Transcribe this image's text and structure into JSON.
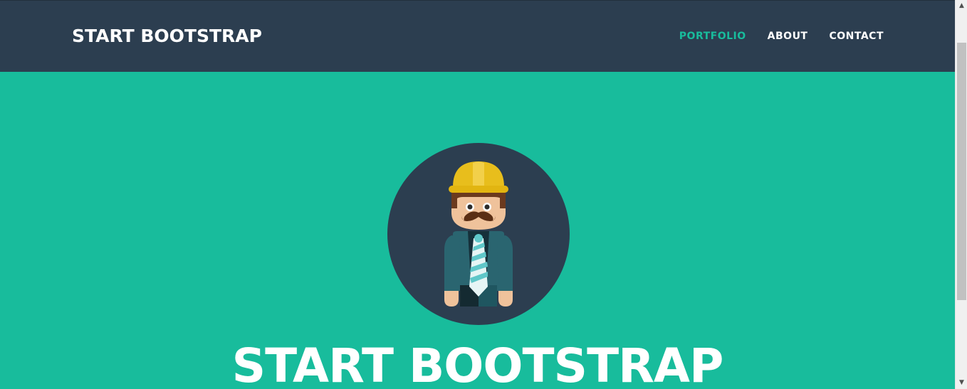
{
  "navbar": {
    "brand": "START BOOTSTRAP",
    "links": [
      {
        "label": "PORTFOLIO",
        "active": true
      },
      {
        "label": "ABOUT",
        "active": false
      },
      {
        "label": "CONTACT",
        "active": false
      }
    ]
  },
  "hero": {
    "title": "START BOOTSTRAP",
    "avatar_icon": "engineer-avatar-icon"
  },
  "scrollbar": {
    "up_icon": "chevron-up-icon",
    "down_icon": "chevron-down-icon"
  },
  "colors": {
    "navbar_bg": "#2c3e50",
    "hero_bg": "#18bc9c",
    "accent": "#18bc9c",
    "text": "#ffffff"
  }
}
